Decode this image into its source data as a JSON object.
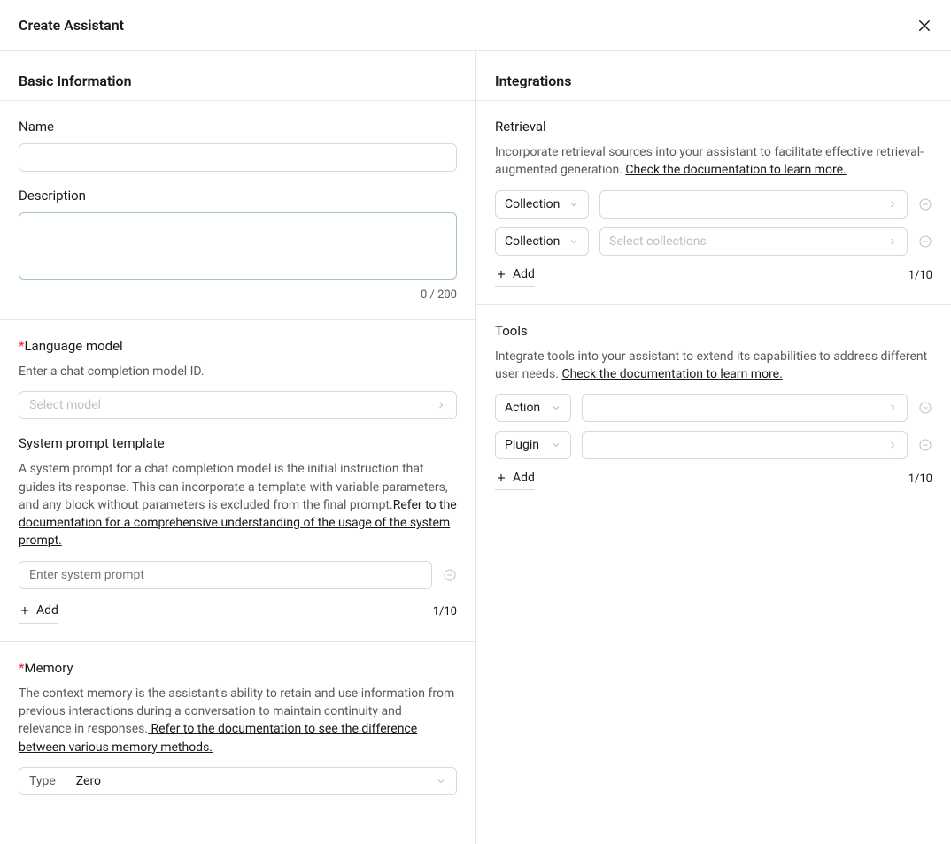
{
  "header": {
    "title": "Create Assistant"
  },
  "left": {
    "panel_title": "Basic Information",
    "name_label": "Name",
    "name_value": "",
    "desc_label": "Description",
    "desc_value": "",
    "desc_counter": "0 / 200",
    "model_label": "Language model",
    "model_desc": "Enter a chat completion model ID.",
    "model_placeholder": "Select model",
    "sys_label": "System prompt template",
    "sys_desc": "A system prompt for a chat completion model is the initial instruction that guides its response. This can incorporate a template with variable parameters, and any block without parameters is excluded from the final prompt.",
    "sys_link": "Refer to the documentation for a comprehensive understanding of the usage of the system prompt.",
    "sys_input_placeholder": "Enter system prompt",
    "sys_add": "Add",
    "sys_counter": "1/10",
    "memory_label": "Memory",
    "memory_desc": "The context memory is the assistant's ability to retain and use information from previous interactions during a conversation to maintain continuity and relevance in responses.",
    "memory_link": " Refer to the documentation to see the difference between various memory methods.",
    "memory_type_label": "Type",
    "memory_type_value": "Zero"
  },
  "right": {
    "panel_title": "Integrations",
    "retrieval": {
      "title": "Retrieval",
      "desc": "Incorporate retrieval sources into your assistant to facilitate effective retrieval-augmented generation. ",
      "link": "Check the documentation to learn more.",
      "rows": [
        {
          "type_label": "Collection",
          "value_placeholder": ""
        },
        {
          "type_label": "Collection",
          "value_placeholder": "Select collections"
        }
      ],
      "add": "Add",
      "counter": "1/10"
    },
    "tools": {
      "title": "Tools",
      "desc": "Integrate tools into your assistant to extend its capabilities to address different user needs. ",
      "link": "Check the documentation to learn more.",
      "rows": [
        {
          "type_label": "Action"
        },
        {
          "type_label": "Plugin"
        }
      ],
      "add": "Add",
      "counter": "1/10"
    }
  }
}
